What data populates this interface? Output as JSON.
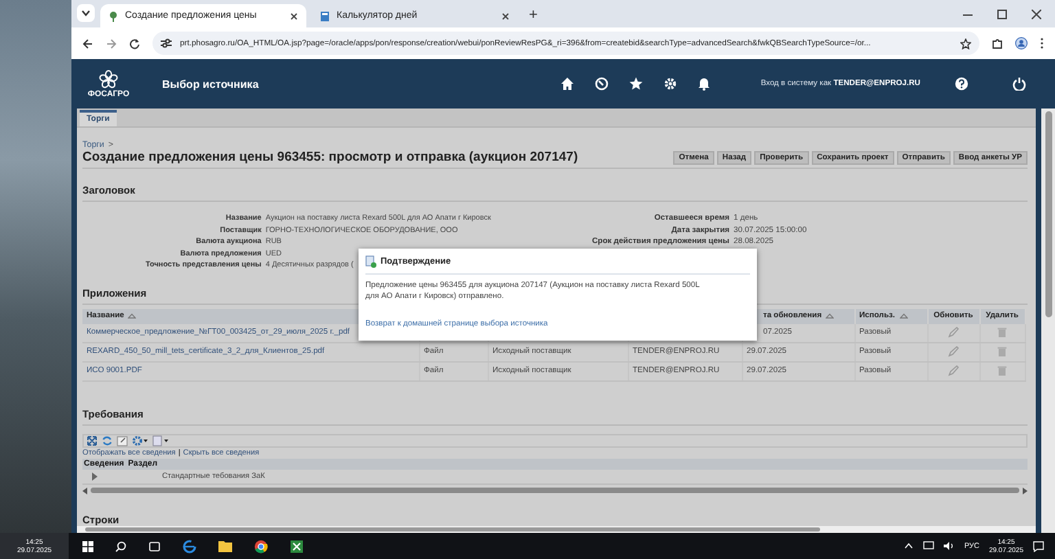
{
  "browser": {
    "tabs": [
      {
        "title": "Создание предложения цены",
        "selected": true
      },
      {
        "title": "Калькулятор дней",
        "selected": false
      }
    ],
    "new_tab": "+",
    "url": "prt.phosagro.ru/OA_HTML/OA.jsp?page=/oracle/apps/pon/response/creation/webui/ponReviewResPG&_ri=396&from=createbid&searchType=advancedSearch&fwkQBSearchTypeSource=/or..."
  },
  "header": {
    "logo_text": "ФОСАГРО",
    "title": "Выбор источника",
    "login": "Вход в систему как **TENDER@ENPROJ.RU**"
  },
  "page_tabs": [
    {
      "label": "Торги",
      "selected": true
    }
  ],
  "breadcrumb": {
    "link": "Торги",
    "separator": ">"
  },
  "page_title": "Создание предложения цены 963455: просмотр и отправка (аукцион 207147)",
  "actions": [
    "Отмена",
    "Назад",
    "Проверить",
    "Сохранить проект",
    "Отправить",
    "Ввод анкеты УР"
  ],
  "header_section": {
    "title": "Заголовок",
    "left_fields": [
      {
        "label": "Название",
        "value": "Аукцион на поставку листа Rexard 500L для АО Апати г Кировск"
      },
      {
        "label": "Поставщик",
        "value": "ГОРНО-ТЕХНОЛОГИЧЕСКОЕ ОБОРУДОВАНИЕ, ООО"
      },
      {
        "label": "Валюта аукциона",
        "value": "RUB"
      },
      {
        "label": "Валюта предложения",
        "value": "UED"
      },
      {
        "label": "Точность представления цены",
        "value": "4 Десятичных разрядов ("
      }
    ],
    "right_fields": [
      {
        "label": "Оставшееся время",
        "value": "1 день"
      },
      {
        "label": "Дата закрытия",
        "value": "30.07.2025 15:00:00"
      },
      {
        "label": "Срок действия предложения цены",
        "value": "28.08.2025"
      }
    ]
  },
  "attachments": {
    "title": "Приложения",
    "columns": {
      "name": "Название",
      "updated": "та обновления",
      "usage": "Использ.",
      "update": "Обновить",
      "delete": "Удалить"
    },
    "rows": [
      {
        "name": "Коммерческое_предложение_№ГТ00_003425_от_29_июля_2025 г._pdf",
        "updated": "07.2025",
        "usage": "Разовый"
      },
      {
        "name": "REXARD_450_50_mill_tets_certificate_3_2_для_Клиентов_25.pdf",
        "type": "Файл",
        "source": "Исходный поставщик",
        "author": "TENDER@ENPROJ.RU",
        "updated": "29.07.2025",
        "usage": "Разовый"
      },
      {
        "name": "ИСО 9001.PDF",
        "type": "Файл",
        "source": "Исходный поставщик",
        "author": "TENDER@ENPROJ.RU",
        "updated": "29.07.2025",
        "usage": "Разовый"
      }
    ]
  },
  "requirements": {
    "title": "Требования",
    "show_all": "Отображать все сведения",
    "separator": "|",
    "hide_all": "Скрыть все сведения",
    "columns": [
      "Сведения",
      "Раздел"
    ],
    "rows": [
      {
        "section": "Стандартные тебования ЗаК",
        "expanded": false
      }
    ]
  },
  "lines_section": {
    "title": "Строки"
  },
  "dialog": {
    "title": "Подтверждение",
    "message": "Предложение цены 963455 для аукциона 207147 (Аукцион на поставку листа Rexard 500L для АО Апати г Кировск) отправлено.",
    "link": "Возврат к домашней странице выбора источника"
  },
  "taskbar": {
    "side_time": "14:25",
    "side_date": "29.07.2025",
    "language": "РУС",
    "time": "14:25",
    "date": "29.07.2025"
  }
}
